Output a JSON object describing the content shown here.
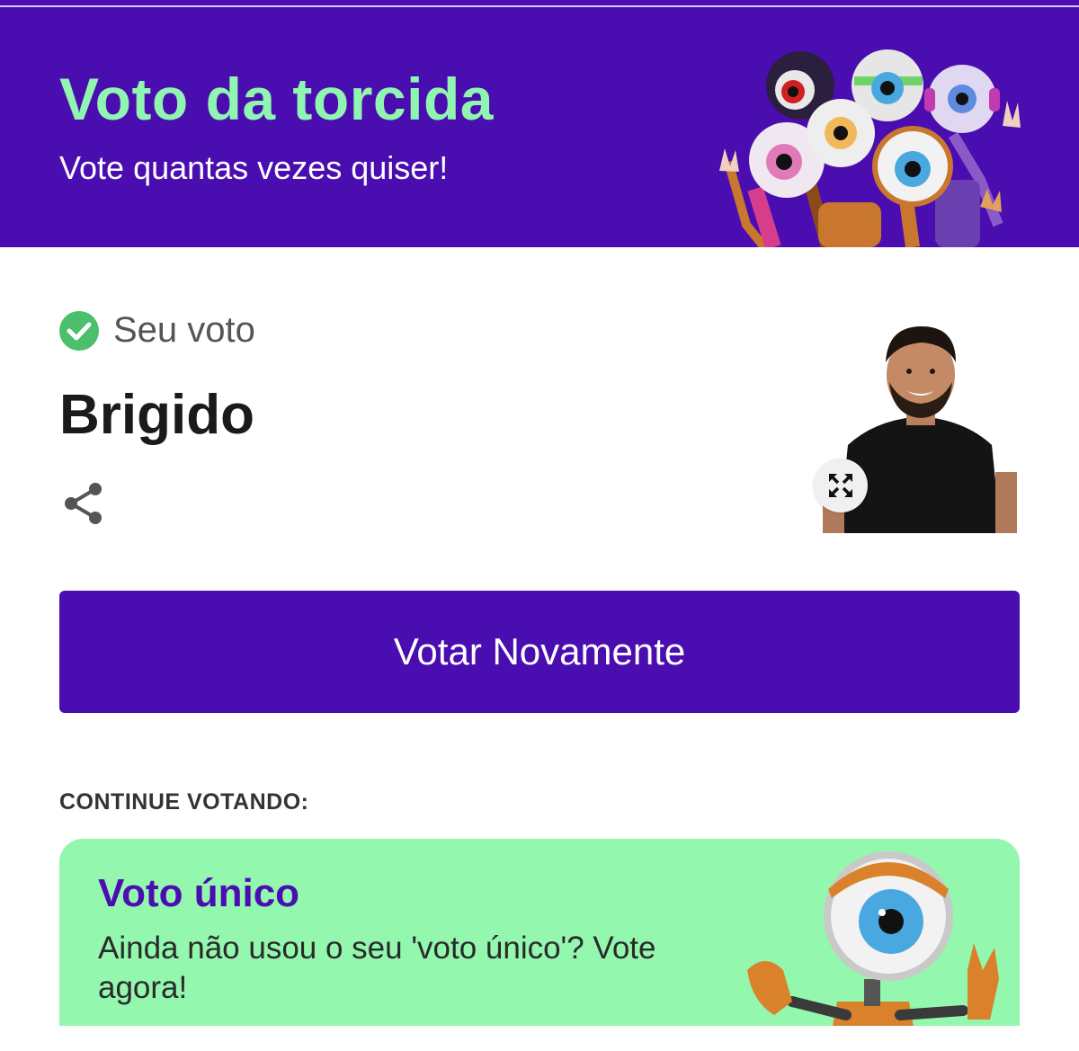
{
  "banner": {
    "title": "Voto da torcida",
    "subtitle": "Vote quantas vezes quiser!",
    "mascots_icon": "bbb-eye-mascots-group"
  },
  "result": {
    "status_label": "Seu voto",
    "status_icon": "check-circle-icon",
    "candidate": "Brigido",
    "share_icon": "share-icon",
    "expand_icon": "expand-icon"
  },
  "actions": {
    "vote_again": "Votar Novamente"
  },
  "continue": {
    "heading": "CONTINUE VOTANDO:",
    "card_title": "Voto único",
    "card_text": "Ainda não usou o seu 'voto único'? Vote agora!",
    "card_icon": "bbb-eye-mascot"
  },
  "colors": {
    "brand_purple": "#4a0db0",
    "accent_green": "#8ff5b0",
    "card_green": "#93f7ae",
    "check_green": "#4cbf6b"
  }
}
